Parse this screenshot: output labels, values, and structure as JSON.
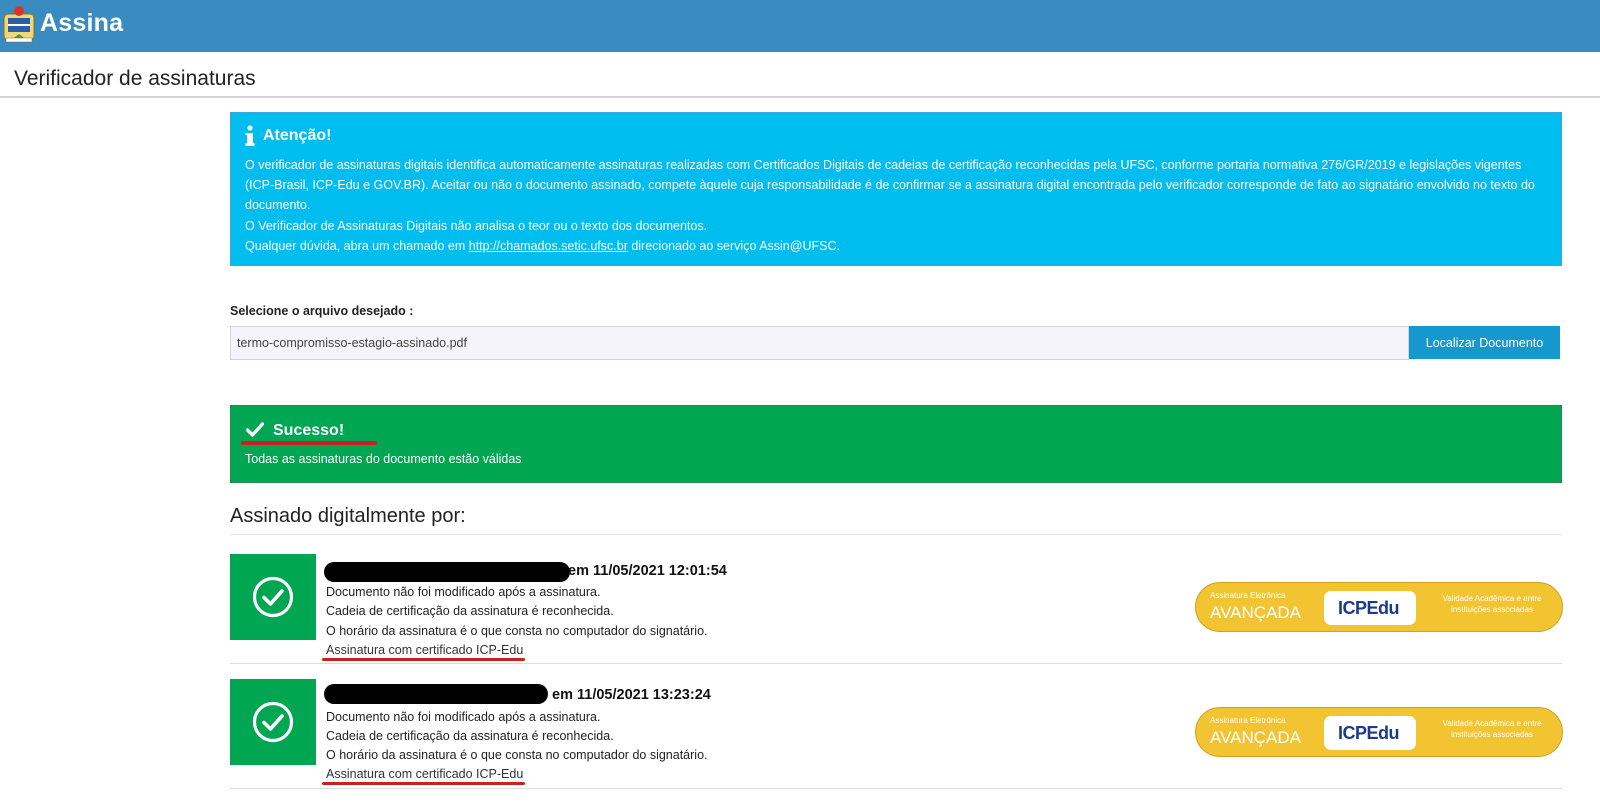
{
  "app": {
    "title": "Assina",
    "logo_icon": "ufsc-crest-icon"
  },
  "page": {
    "title": "Verificador de assinaturas"
  },
  "info_alert": {
    "icon": "info-icon",
    "title": "Atenção!",
    "para1": "O verificador de assinaturas digitais identifica automaticamente assinaturas realizadas com Certificados Digitais de cadeias de certificação reconhecidas pela UFSC, conforme portaria normativa 276/GR/2019 e legislações vigentes (ICP-Brasil, ICP-Edu e GOV.BR). Aceitar ou não o documento assinado, compete àquele cuja responsabilidade é de confirmar se a assinatura digital encontrada pelo verificador corresponde de fato ao signatário envolvido no texto do documento.",
    "para2": "O Verificador de Assinaturas Digitais não analisa o teor ou o texto dos documentos.",
    "para3_prefix": "Qualquer dúvida, abra um chamado em ",
    "para3_link": "http://chamados.setic.ufsc.br",
    "para3_suffix": " direcionado ao serviço Assin@UFSC."
  },
  "file_select": {
    "label": "Selecione o arquivo desejado :",
    "value": "termo-compromisso-estagio-assinado.pdf",
    "button": "Localizar Documento"
  },
  "success_alert": {
    "icon": "check-icon",
    "title": "Sucesso!",
    "message": "Todas as assinaturas do documento estão válidas"
  },
  "signed_by": {
    "heading": "Assinado digitalmente por:",
    "signatures": [
      {
        "when": "em 11/05/2021 12:01:54",
        "line1": "Documento não foi modificado após a assinatura.",
        "line2": "Cadeia de certificação da assinatura é reconhecida.",
        "line3": "O horário da assinatura é o que consta no computador do signatário.",
        "cert": "Assinatura com certificado ICP-Edu"
      },
      {
        "when": "em 11/05/2021 13:23:24",
        "line1": "Documento não foi modificado após a assinatura.",
        "line2": "Cadeia de certificação da assinatura é reconhecida.",
        "line3": "O horário da assinatura é o que consta no computador do signatário.",
        "cert": "Assinatura com certificado ICP-Edu"
      }
    ]
  },
  "badge": {
    "small": "Assinatura Eletrônica",
    "big": "AVANÇADA",
    "logo": "ICPEdu",
    "note": "Validade Acadêmica e entre instituições associadas"
  },
  "colors": {
    "topbar": "#3a8bbf",
    "info": "#00bdf0",
    "success": "#00a651",
    "button": "#1498cd",
    "badge": "#f2c431",
    "annotation_red": "#cc1f1f"
  }
}
